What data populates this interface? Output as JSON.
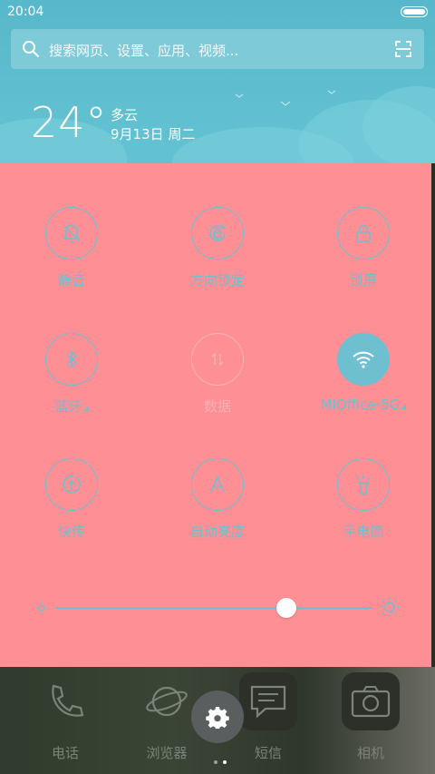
{
  "status_bar": {
    "time": "20:04"
  },
  "search": {
    "placeholder": "搜索网页、设置、应用、视频..."
  },
  "weather": {
    "temperature": "24°",
    "condition": "多云",
    "date": "9月13日 周二"
  },
  "toggles": [
    {
      "label": "静音",
      "icon": "bell-off-icon",
      "state": "off"
    },
    {
      "label": "方向锁定",
      "icon": "rotation-lock-icon",
      "state": "off"
    },
    {
      "label": "锁屏",
      "icon": "lock-icon",
      "state": "off"
    },
    {
      "label": "蓝牙",
      "icon": "bluetooth-icon",
      "state": "off",
      "has_more": true
    },
    {
      "label": "数据",
      "icon": "mobile-data-icon",
      "state": "disabled"
    },
    {
      "label": "MIOffice-5G",
      "icon": "wifi-icon",
      "state": "on",
      "has_more": true
    },
    {
      "label": "快传",
      "icon": "share-transfer-icon",
      "state": "off"
    },
    {
      "label": "自动亮度",
      "icon": "auto-brightness-icon",
      "state": "off"
    },
    {
      "label": "手电筒",
      "icon": "flashlight-icon",
      "state": "off"
    }
  ],
  "brightness": {
    "level": 0.73
  },
  "dock": [
    {
      "label": "电话",
      "icon": "phone-icon"
    },
    {
      "label": "浏览器",
      "icon": "browser-icon"
    },
    {
      "label": "短信",
      "icon": "message-icon"
    },
    {
      "label": "相机",
      "icon": "camera-icon"
    }
  ],
  "colors": {
    "accent": "#6ebfd0",
    "panel": "#fe9095",
    "header": "#5fbfd0"
  }
}
